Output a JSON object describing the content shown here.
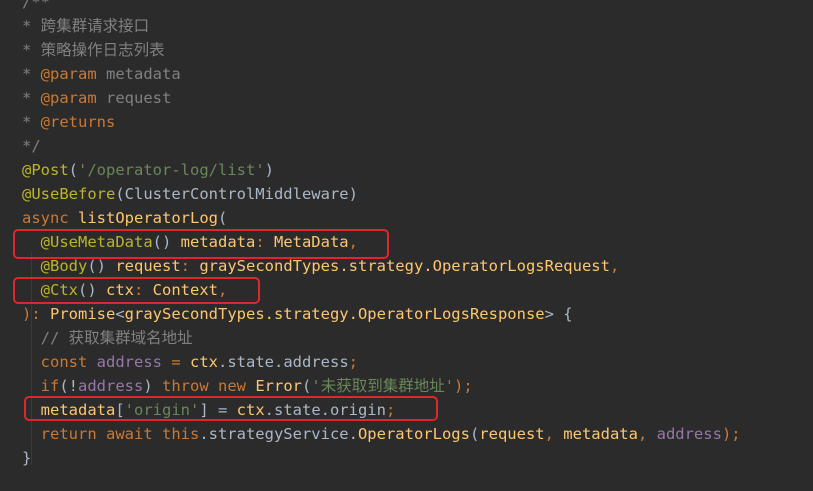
{
  "editor": {
    "lines": [
      [
        {
          "t": "/**",
          "c": "c-comment"
        }
      ],
      [
        {
          "t": "* ",
          "c": "c-comment"
        },
        {
          "t": "跨集群请求接口",
          "c": "c-comment"
        }
      ],
      [
        {
          "t": "* ",
          "c": "c-comment"
        },
        {
          "t": "策略操作日志列表",
          "c": "c-comment"
        }
      ],
      [
        {
          "t": "* ",
          "c": "c-comment"
        },
        {
          "t": "@param",
          "c": "c-tag"
        },
        {
          "t": " metadata",
          "c": "c-comment"
        }
      ],
      [
        {
          "t": "* ",
          "c": "c-comment"
        },
        {
          "t": "@param",
          "c": "c-tag"
        },
        {
          "t": " request",
          "c": "c-comment"
        }
      ],
      [
        {
          "t": "* ",
          "c": "c-comment"
        },
        {
          "t": "@returns",
          "c": "c-tag"
        }
      ],
      [
        {
          "t": "*/",
          "c": "c-comment"
        }
      ],
      [
        {
          "t": "@Post",
          "c": "c-ann"
        },
        {
          "t": "(",
          "c": "c-def"
        },
        {
          "t": "'/operator-log/list'",
          "c": "c-str"
        },
        {
          "t": ")",
          "c": "c-def"
        }
      ],
      [
        {
          "t": "@UseBefore",
          "c": "c-ann"
        },
        {
          "t": "(ClusterControlMiddleware)",
          "c": "c-def"
        }
      ],
      [
        {
          "t": "async ",
          "c": "c-kw"
        },
        {
          "t": "listOperatorLog",
          "c": "c-fn"
        },
        {
          "t": "(",
          "c": "c-def"
        }
      ],
      [
        {
          "t": "  ",
          "c": "c-def"
        },
        {
          "t": "@UseMetaData",
          "c": "c-ann"
        },
        {
          "t": "() ",
          "c": "c-def"
        },
        {
          "t": "metadata",
          "c": "c-param"
        },
        {
          "t": ": ",
          "c": "c-kw"
        },
        {
          "t": "MetaData",
          "c": "c-type"
        },
        {
          "t": ",",
          "c": "c-kw"
        }
      ],
      [
        {
          "t": "  ",
          "c": "c-def"
        },
        {
          "t": "@Body",
          "c": "c-ann"
        },
        {
          "t": "() ",
          "c": "c-def"
        },
        {
          "t": "request",
          "c": "c-param"
        },
        {
          "t": ": ",
          "c": "c-kw"
        },
        {
          "t": "graySecondTypes.strategy.OperatorLogsRequest",
          "c": "c-type"
        },
        {
          "t": ",",
          "c": "c-kw"
        }
      ],
      [
        {
          "t": "  ",
          "c": "c-def"
        },
        {
          "t": "@Ctx",
          "c": "c-ann"
        },
        {
          "t": "() ",
          "c": "c-def"
        },
        {
          "t": "ctx",
          "c": "c-param"
        },
        {
          "t": ": ",
          "c": "c-kw"
        },
        {
          "t": "Context",
          "c": "c-type"
        },
        {
          "t": ",",
          "c": "c-kw"
        }
      ],
      [
        {
          "t": "): ",
          "c": "c-kw"
        },
        {
          "t": "Promise",
          "c": "c-type"
        },
        {
          "t": "<",
          "c": "c-def"
        },
        {
          "t": "graySecondTypes.strategy.OperatorLogsResponse",
          "c": "c-type"
        },
        {
          "t": "> {",
          "c": "c-def"
        }
      ],
      [
        {
          "t": "  ",
          "c": "c-def"
        },
        {
          "t": "// 获取集群域名地址",
          "c": "c-comment"
        }
      ],
      [
        {
          "t": "  ",
          "c": "c-def"
        },
        {
          "t": "const ",
          "c": "c-kw"
        },
        {
          "t": "address",
          "c": "c-prop"
        },
        {
          "t": " = ",
          "c": "c-kw"
        },
        {
          "t": "ctx",
          "c": "c-param"
        },
        {
          "t": ".state.address",
          "c": "c-def"
        },
        {
          "t": ";",
          "c": "c-kw"
        }
      ],
      [
        {
          "t": "  ",
          "c": "c-def"
        },
        {
          "t": "if",
          "c": "c-kw"
        },
        {
          "t": "(!",
          "c": "c-def"
        },
        {
          "t": "address",
          "c": "c-prop"
        },
        {
          "t": ") ",
          "c": "c-def"
        },
        {
          "t": "throw new ",
          "c": "c-kw"
        },
        {
          "t": "Error",
          "c": "c-type"
        },
        {
          "t": "(",
          "c": "c-def"
        },
        {
          "t": "'未获取到集群地址'",
          "c": "c-str"
        },
        {
          "t": ");",
          "c": "c-kw"
        }
      ],
      [
        {
          "t": "  ",
          "c": "c-def"
        },
        {
          "t": "metadata",
          "c": "c-param"
        },
        {
          "t": "[",
          "c": "c-def"
        },
        {
          "t": "'origin'",
          "c": "c-str"
        },
        {
          "t": "] = ",
          "c": "c-def"
        },
        {
          "t": "ctx",
          "c": "c-param"
        },
        {
          "t": ".state.origin",
          "c": "c-def"
        },
        {
          "t": ";",
          "c": "c-kw"
        }
      ],
      [
        {
          "t": "  ",
          "c": "c-def"
        },
        {
          "t": "return await this",
          "c": "c-kw"
        },
        {
          "t": ".strategyService.",
          "c": "c-def"
        },
        {
          "t": "OperatorLogs",
          "c": "c-fn"
        },
        {
          "t": "(",
          "c": "c-def"
        },
        {
          "t": "request",
          "c": "c-param"
        },
        {
          "t": ", ",
          "c": "c-kw"
        },
        {
          "t": "metadata",
          "c": "c-param"
        },
        {
          "t": ", ",
          "c": "c-kw"
        },
        {
          "t": "address",
          "c": "c-prop"
        },
        {
          "t": ");",
          "c": "c-kw"
        }
      ],
      [
        {
          "t": "}",
          "c": "c-def"
        }
      ]
    ]
  },
  "highlights": [
    {
      "line": 11
    },
    {
      "line": 13
    },
    {
      "line": 18
    }
  ]
}
